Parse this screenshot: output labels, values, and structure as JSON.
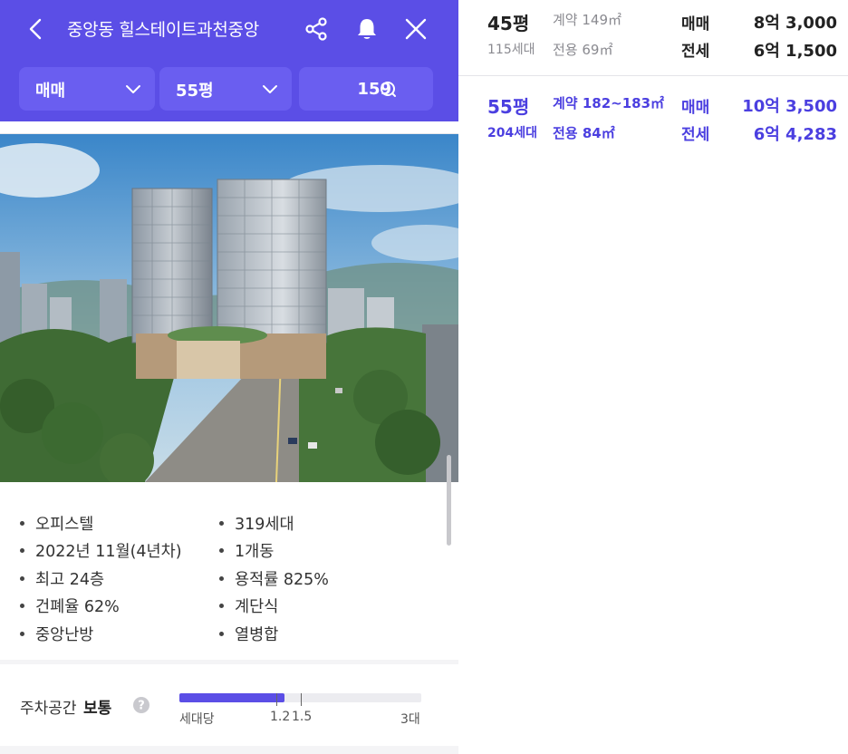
{
  "header": {
    "title": "중앙동 힐스테이트과천중앙",
    "icons": {
      "back": "chevron-left-icon",
      "share": "share-icon",
      "alarm": "bell-icon",
      "close": "close-icon"
    },
    "accent_color": "#5b4ee6"
  },
  "filters": {
    "trade_type": "매매",
    "size": "55평",
    "listing_count": "159"
  },
  "info": {
    "col1": [
      "오피스텔",
      "2022년 11월(4년차)",
      "최고 24층",
      "건폐율 62%",
      "중앙난방"
    ],
    "col2": [
      "319세대",
      "1개동",
      "용적률 825%",
      "계단식",
      "열병합"
    ]
  },
  "parking": {
    "label": "주차공간",
    "level": "보통",
    "per_household": 1.3,
    "max": 3,
    "unit_label": "세대당",
    "tick_1": "1.2",
    "tick_2": "1.5",
    "max_label": "3대"
  },
  "units": [
    {
      "size": "45평",
      "households": "115세대",
      "contract_area": "계약 149㎡",
      "net_area": "전용 69㎡",
      "trade1": "매매",
      "price1": "8억 3,000",
      "trade2": "전세",
      "price2": "6억 1,500",
      "highlighted": false
    },
    {
      "size": "55평",
      "households": "204세대",
      "contract_area": "계약 182~183㎡",
      "net_area": "전용 84㎡",
      "trade1": "매매",
      "price1": "10억 3,500",
      "trade2": "전세",
      "price2": "6억 4,283",
      "highlighted": true
    }
  ]
}
